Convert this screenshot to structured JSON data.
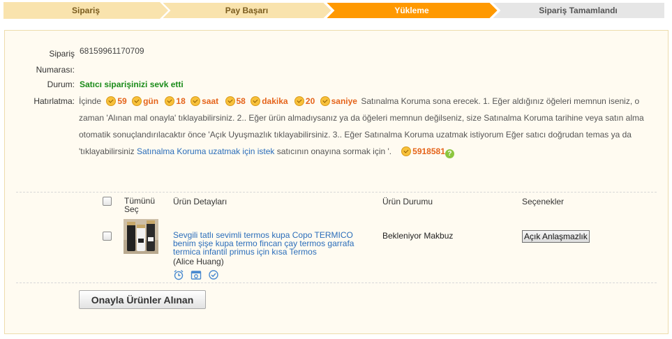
{
  "steps": [
    {
      "label": "Sipariş",
      "state": "done"
    },
    {
      "label": "Pay Başarı",
      "state": "done"
    },
    {
      "label": "Yükleme",
      "state": "active"
    },
    {
      "label": "Sipariş Tamamlandı",
      "state": "pending"
    }
  ],
  "colors": {
    "step_done": "#f9e3ad",
    "step_done_text": "#7a5c1e",
    "step_active": "#ff9900",
    "step_pending": "#e6e6e6",
    "accent": "#e5641b",
    "link": "#2a6dba",
    "status_green": "#1a8c1a"
  },
  "order": {
    "number_label_1": "Sipariş",
    "number_label_2": "Numarası:",
    "number": "68159961170709",
    "status_label": "Durum:",
    "status": "Satıcı siparişinizi sevk etti",
    "reminder_label": "Hatırlatma:"
  },
  "reminder": {
    "prefix": "İçinde",
    "days": "59",
    "days_unit": "gün",
    "hours": "18",
    "hours_unit": "saat",
    "minutes": "58",
    "minutes_unit": "dakika",
    "seconds": "20",
    "seconds_unit": "saniye",
    "text1": "Satınalma Koruma sona erecek. 1. Eğer aldığınız öğeleri memnun iseniz, o zaman 'Alınan mal onayla' tıklayabilirsiniz. 2.. Eğer ürün almadıysanız ya da öğeleri memnun değilseniz, size Satınalma Koruma tarihine veya satın alma otomatik sonuçlandırılacaktır önce 'Açık Uyuşmazlık tıklayabilirsiniz. 3.. Eğer Satınalma Koruma uzatmak istiyorum Eğer satıcı doğrudan temas ya da 'tıklayabilirsiniz",
    "link": "Satınalma Koruma uzatmak için istek",
    "text2": "satıcının onayına sormak için '.",
    "points": "5918581",
    "help_icon": "?"
  },
  "table": {
    "headers": {
      "select_all": "Tümünü Seç",
      "details": "Ürün Detayları",
      "status": "Ürün Durumu",
      "options": "Seçenekler"
    },
    "rows": [
      {
        "title": "Sevgili tatlı sevimli termos kupa Copo TERMICO benim şişe kupa termo fincan çay termos garrafa termica infantil primus için kısa Termos",
        "seller": "(Alice Huang)",
        "status": "Bekleniyor Makbuz",
        "action": "Açık Anlaşmazlık",
        "tools": [
          "alarm-clock-icon",
          "image-icon",
          "check-circle-icon"
        ]
      }
    ]
  },
  "confirm_button": "Onayla Ürünler Alınan"
}
